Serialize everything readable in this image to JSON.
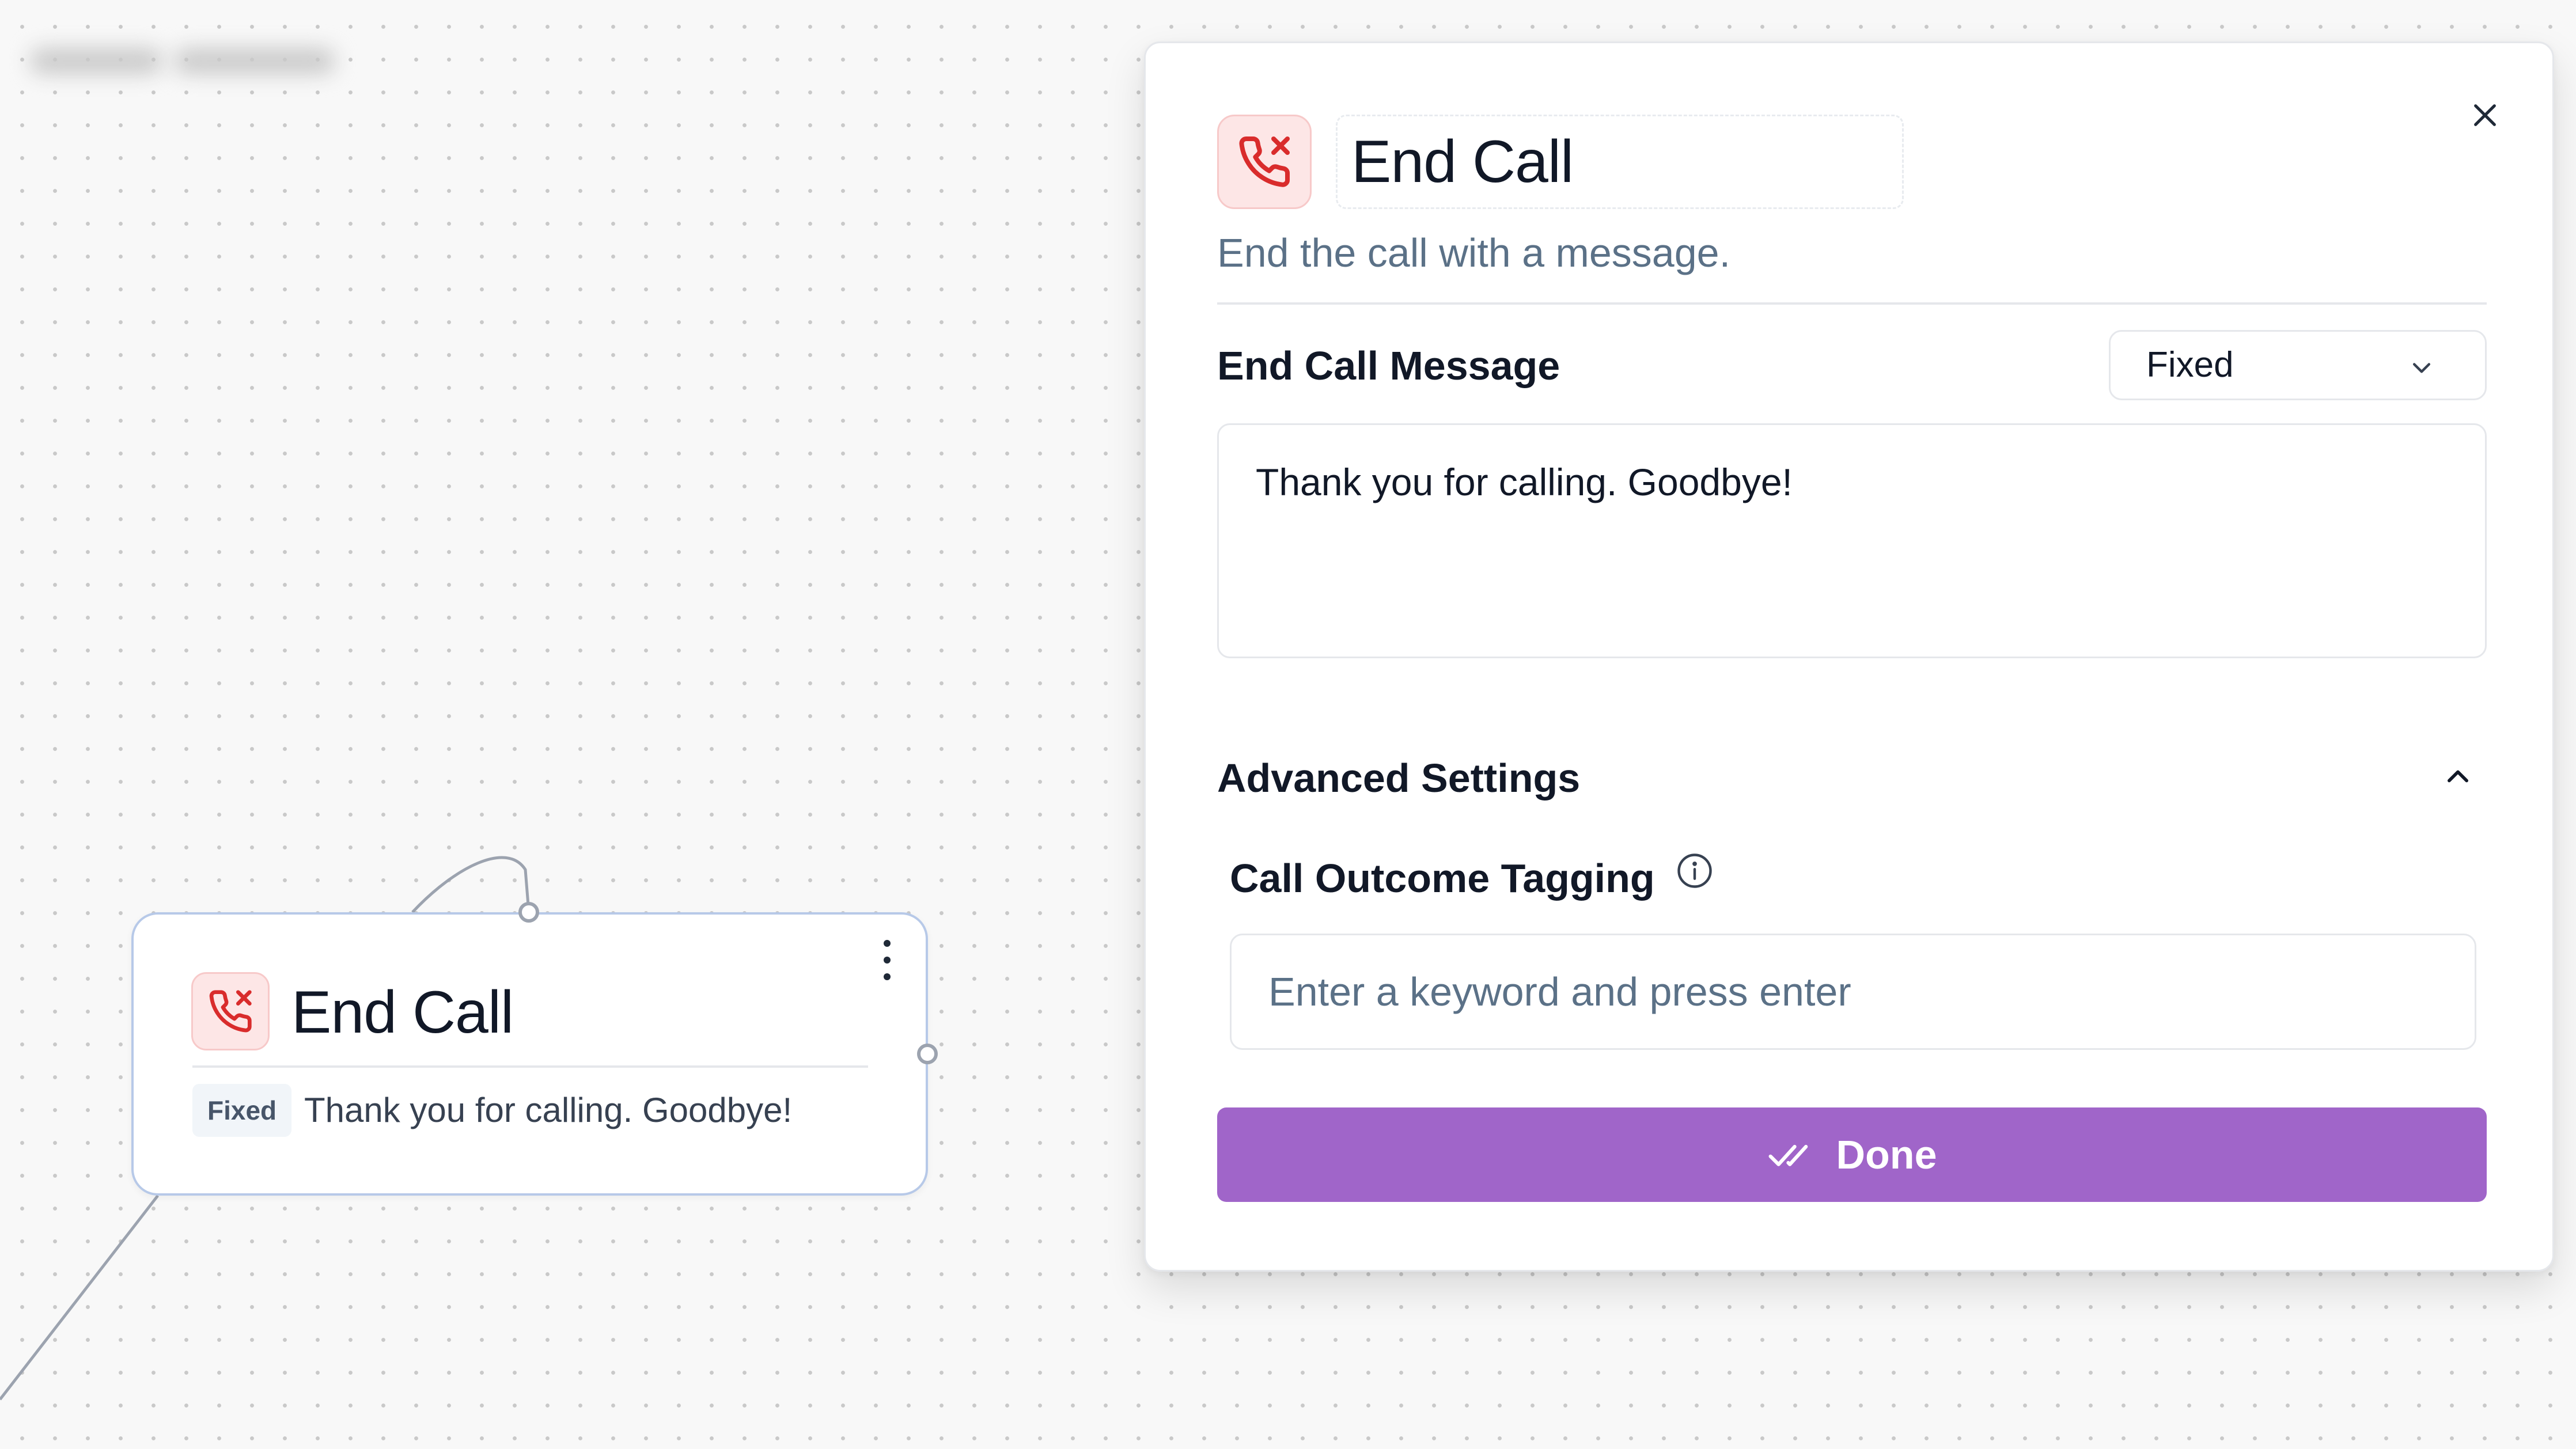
{
  "canvas": {
    "blurred_label": "",
    "node": {
      "title": "End Call",
      "badge": "Fixed",
      "message": "Thank you for calling. Goodbye!"
    }
  },
  "panel": {
    "title": "End Call",
    "subtitle": "End the call with a message.",
    "message_field": {
      "label": "End Call Message",
      "mode": "Fixed",
      "value": "Thank you for calling. Goodbye!"
    },
    "advanced": {
      "label": "Advanced Settings",
      "expanded": true,
      "call_outcome_tagging": {
        "label": "Call Outcome Tagging",
        "placeholder": "Enter a keyword and press enter"
      }
    },
    "done_button": "Done"
  },
  "icons": [
    "phone-end-icon",
    "close-icon",
    "chevron-down-icon",
    "chevron-up-icon",
    "info-icon",
    "double-check-icon",
    "more-vertical-icon"
  ],
  "colors": {
    "accent": "#a065c9",
    "danger": "#d92c2c",
    "danger_bg": "#fde6e6",
    "muted_text": "#5b7187",
    "node_border": "#b7c9e8"
  }
}
